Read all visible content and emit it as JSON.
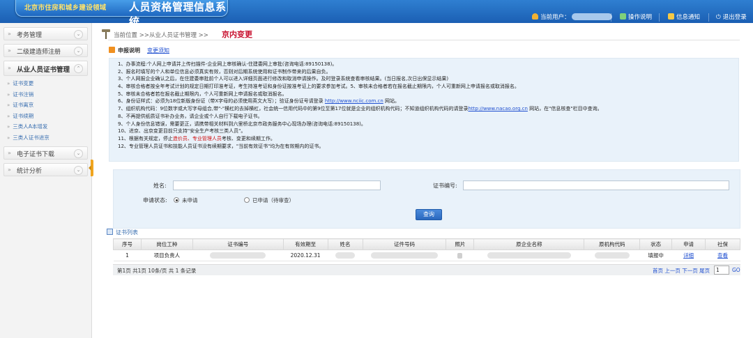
{
  "header": {
    "logo_prefix": "北京市住房和城乡建设领域",
    "logo_main": "人员资格管理信息系统",
    "current_user_label": "当前用户：",
    "ops_label": "操作说明",
    "notice_label": "信息通知",
    "logout_label": "退出登录"
  },
  "sidebar": {
    "categories": [
      {
        "label": "考务管理"
      },
      {
        "label": "二级建造师注册"
      },
      {
        "label": "从业人员证书管理"
      },
      {
        "label": "电子证书下载"
      },
      {
        "label": "统计分析"
      }
    ],
    "sub_items": [
      {
        "label": "证书变更"
      },
      {
        "label": "证书注销"
      },
      {
        "label": "证书离京"
      },
      {
        "label": "证书续期"
      },
      {
        "label": "三类人A本增发"
      },
      {
        "label": "三类人证书进京"
      }
    ]
  },
  "breadcrumb": {
    "prefix": "当前位置 >>从业人员证书管理 >>",
    "current": "京内变更"
  },
  "notice": {
    "title": "申报说明",
    "link": "变更须知",
    "lines": [
      {
        "text": "1、办事流程:个人网上申请并上传扫描件-企业网上审核确认-住建委网上审批(咨询电话:89150138)。"
      },
      {
        "text": "2、报名时填写的个人和单位信息必须真实有效，否则对后期系统使用和证书制作带来的后果自负。"
      },
      {
        "text": "3、个人网报企业确认之后，在住建委审批前个人可以进入详细页面进行修改和取消申请操作。及时登录系统查看审核结果。(当日报名,次日出保显示结果)"
      },
      {
        "text": "4、审核合格者按全年考试计划的规定日期打印准考证，考生持准考证和身份证按准考证上的要求参加考试。5、审核未合格者若在报名截止期限内，个人可重新网上申请报名或取消报名。"
      },
      {
        "text": "5、审核未合格者若在报名截止期限内，个人可重新网上申请报名或取消报名。"
      },
      {
        "pre": "6、身份证样式：必须为18位新版身份证（带X字母的必须使用英文大写）；验证身份证号请登录 ",
        "link": "http://www.nciic.com.cn",
        "post": " 网站。"
      },
      {
        "pre": "7、组织机构代码：9位数字或大写字母组合,带\"-\"横杠的去掉横杠，社会统一信用代码中的第9位至第17位就是企业的组织机构代码；不知道组织机构代码的请登录",
        "link": "http://www.nacao.org.cn",
        "post": " 网站，在\"信息核查\"栏目中查询。"
      },
      {
        "text": "8、不再提供纸质证书补办业务，请企业或个人自行下载电子证书。"
      },
      {
        "text": "9、个人身份信息错误，需要更正，请携带相关材料到六里桥北京市政务服务中心现场办理(咨询电话:89150138)。"
      },
      {
        "text": "10、进京、出京变更目前只支持\"安全生产考核三类人员\"。"
      },
      {
        "pre": "11、根据有关规定，停止",
        "red": "造价员、专业管理人员",
        "post": "考核、变更和续期工作。"
      },
      {
        "text": "12、专业管理人员证书和技能人员证书没有续期要求，\"当前有效证书\"均为在有效期内的证书。"
      }
    ]
  },
  "search": {
    "name_label": "姓名:",
    "name_value": "",
    "cert_no_label": "证书编号:",
    "cert_no_value": "",
    "status_label": "申请状态:",
    "status_options": [
      "未申请",
      "已申请（待审查）"
    ],
    "status_selected": "未申请",
    "query_button": "查询"
  },
  "cert_list": {
    "title": "证书列表",
    "columns": [
      "序号",
      "岗位工种",
      "证书编号",
      "有效期至",
      "姓名",
      "证件号码",
      "照片",
      "原企业名称",
      "原机构代码",
      "状态",
      "申请",
      "社保"
    ],
    "rows": [
      {
        "no": "1",
        "job": "项目负责人",
        "valid_until": "2020.12.31",
        "status": "填报中",
        "apply": "详细",
        "social": "查看"
      }
    ]
  },
  "pager": {
    "info": "第1页 共1页 10条/页 共 1 条记录",
    "nav": "首页 上一页 下一页 尾页",
    "page_value": "1",
    "go": "GO"
  },
  "colors": {
    "header_blue": "#1b5fb3",
    "logo_yellow": "#ffe36a",
    "breadcrumb_red": "#c8102e",
    "link_blue": "#1f4fd0",
    "panel_bg": "#e9f2fa"
  }
}
